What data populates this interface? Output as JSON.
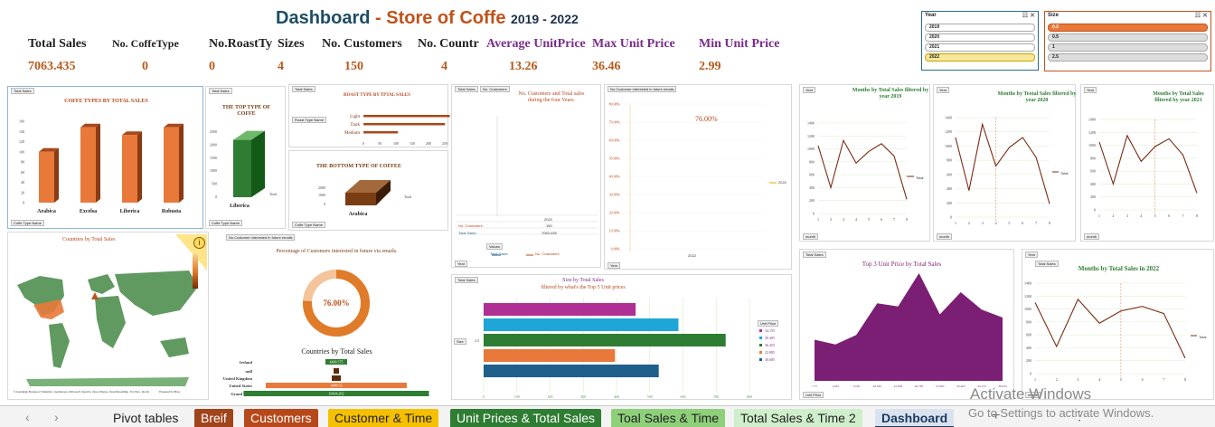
{
  "header": {
    "title_a": "Dashboard",
    "title_sep": " - ",
    "title_b": "Store of Coffe",
    "years": "2019 - 2022"
  },
  "kpis": [
    {
      "label": "Total Sales",
      "value": "7063.435"
    },
    {
      "label": "No. CoffeType",
      "value": "0"
    },
    {
      "label": "No.RoastTy",
      "value": "0"
    },
    {
      "label": "Sizes",
      "value": "4"
    },
    {
      "label": "No. Customers",
      "value": "150"
    },
    {
      "label": "No. Countr",
      "value": "4"
    },
    {
      "label": "Average UnitPrice",
      "value": "13.26"
    },
    {
      "label": "Max Unit Price",
      "value": "36.46"
    },
    {
      "label": "Min Unit Price",
      "value": "2.99"
    }
  ],
  "slicers": {
    "year": {
      "title": "Year",
      "items": [
        "2019",
        "2020",
        "2021",
        "2022"
      ],
      "selected": "2022"
    },
    "size": {
      "title": "Size",
      "items": [
        "0.2",
        "0.5",
        "1",
        "2.5"
      ],
      "selected": "0.2"
    }
  },
  "buttons": {
    "total_sales": "Total Sales",
    "no_customers": "No. Customers",
    "coffee_type_name": "Coffe Type Name",
    "roast_type_name": "Roast Type Name",
    "sum_customers": "No.Customer interested in future emails",
    "values": "Values",
    "year": "Year",
    "month": "month",
    "size": "Size",
    "unit_price": "Unit Price"
  },
  "colors": {
    "orange": "#e8793a",
    "brown": "#7a3c12",
    "green": "#2e7d32",
    "purple": "#7b1f74",
    "blue": "#1f5f8b",
    "cyan": "#1fa6d8",
    "magenta": "#b02f95",
    "dashboard_tab": "#d9e3f0"
  },
  "panels": {
    "coffee_types": {
      "title": "COFFE TYPES  BY  TOTAL SALES"
    },
    "top_type": {
      "title": "THE TOP TYPE OF COFFE"
    },
    "roast_type": {
      "title": "ROAST TYPE BY TPTAL SALES"
    },
    "bottom_type": {
      "title": "THE BOTTOM TYPE OF COFFEE"
    },
    "customers_sales": {
      "title": "No. Customers and Total sales during the four Years.",
      "legend_customers": "No. Customers",
      "legend_sales": "Total Sales",
      "customers_value": "150",
      "sales_value": "7063.435",
      "year_label": "2022"
    },
    "pct_line": {
      "pct": "76.00%",
      "legend": "2022",
      "x": "2022"
    },
    "countries_map": {
      "title": "Countries by Total Sales",
      "badge": "i",
      "credit": "© Australian Bureau of Statistics, GeoNames, Microsoft, Navinfo, Open Places, OpenStreetMap, TomTom, Zenrin",
      "powered": "Powered by Bing"
    },
    "email_pct": {
      "title": "Percentage of Customers interested in future via emails.",
      "value": "76.00%"
    },
    "size_sales": {
      "title": "Size by Total Sales",
      "subtitle": "filtered by what's the Top 5 Unit prices",
      "legend": [
        "34.155",
        "30.405",
        "36.455",
        "22.885",
        "30.685"
      ]
    },
    "top3": {
      "title": "Top 3 Unit Price by Total Sales"
    },
    "m2019": {
      "title": "Months by Total Sales filtered by year 2019"
    },
    "m2020": {
      "title": "Months by Teotal Sales filtered by year 2020"
    },
    "m2021": {
      "title": "Months by Total Sales filtered by year 2021"
    },
    "m2022": {
      "title": "Months by Total Sales in 2022"
    },
    "series_total": "Total"
  },
  "tabs": [
    "Pivot tables",
    "Breif",
    "Customers",
    "Customer & Time",
    "Unit Prices & Total Sales",
    "Toal Sales & Time",
    "Total Sales & Time 2",
    "Dashboard"
  ],
  "activate": {
    "line1": "Activate Windows",
    "line2": "Go to Settings to activate Windows."
  },
  "chart_data": [
    {
      "type": "bar",
      "title": "COFFE TYPES  BY  TOTAL SALES",
      "categories": [
        "Arabica",
        "Excelsa",
        "Liberica",
        "Robusta"
      ],
      "values": [
        100,
        148,
        133,
        148
      ],
      "y_ticks": [
        "0",
        "20",
        "40",
        "60",
        "80",
        "100",
        "120",
        "140",
        "160"
      ],
      "ylim": [
        0,
        160
      ]
    },
    {
      "type": "bar",
      "title": "THE TOP TYPE OF COFFE",
      "categories": [
        "Liberica"
      ],
      "values": [
        2200
      ],
      "y_ticks": [
        "0",
        "500",
        "1000",
        "1500",
        "2000",
        "2500"
      ],
      "legend": "Total"
    },
    {
      "type": "bar",
      "title": "ROAST TYPE BY TPTAL SALES",
      "categories": [
        "Light",
        "Dark",
        "Medium"
      ],
      "values": [
        270,
        255,
        108
      ],
      "x_ticks": [
        "0",
        "50",
        "100",
        "150",
        "200",
        "250"
      ],
      "xlim": [
        0,
        300
      ]
    },
    {
      "type": "bar",
      "title": "THE BOTTOM TYPE OF COFFEE",
      "categories": [
        "Arabica"
      ],
      "values": [
        1500
      ],
      "y_ticks": [
        "0",
        "1000",
        "2000"
      ],
      "legend": "Total"
    },
    {
      "type": "area",
      "title": "Top 3 Unit Price by Total Sales",
      "x": [
        "7.77",
        "14.85",
        "15.85",
        "20.585",
        "22.885",
        "29.785",
        "31.085",
        "33.465",
        "34.155",
        "36.455"
      ],
      "values": [
        260,
        230,
        290,
        490,
        470,
        680,
        420,
        560,
        450,
        400
      ],
      "ylim": [
        0,
        800
      ]
    },
    {
      "type": "line",
      "title": "Months by Total Sales filtered by year 2019",
      "x": [
        1,
        2,
        3,
        4,
        5,
        6,
        7,
        8
      ],
      "values": [
        1050,
        400,
        1130,
        780,
        960,
        1080,
        890,
        220
      ],
      "y_ticks": [
        "0",
        "200",
        "400",
        "600",
        "800",
        "1000",
        "1200",
        "1400"
      ],
      "ylim": [
        0,
        1400
      ]
    },
    {
      "type": "line",
      "title": "Months by Teotal Sales filtered by year 2020",
      "x": [
        1,
        2,
        3,
        4,
        5,
        6,
        7,
        8
      ],
      "values": [
        1200,
        400,
        1400,
        770,
        1050,
        1200,
        900,
        200
      ],
      "y_ticks": [
        "0",
        "200",
        "400",
        "600",
        "800",
        "1000",
        "1200",
        "1400"
      ],
      "ylim": [
        0,
        1500
      ]
    },
    {
      "type": "line",
      "title": "Months by Total Sales filtered by year 2021",
      "x": [
        1,
        2,
        3,
        4,
        5,
        6,
        7,
        8
      ],
      "values": [
        1050,
        400,
        1150,
        750,
        980,
        1100,
        850,
        260
      ],
      "y_ticks": [
        "0",
        "200",
        "400",
        "600",
        "800",
        "1000",
        "1200",
        "1400"
      ],
      "ylim": [
        0,
        1400
      ]
    },
    {
      "type": "line",
      "title": "Months by Total Sales in 2022",
      "x": [
        1,
        2,
        3,
        4,
        5,
        6,
        7,
        8
      ],
      "values": [
        1100,
        420,
        1150,
        780,
        970,
        1040,
        930,
        240
      ],
      "y_ticks": [
        "0",
        "200",
        "400",
        "600",
        "800",
        "1000",
        "1200",
        "1400"
      ],
      "ylim": [
        0,
        1400
      ]
    },
    {
      "type": "bar",
      "title": "Size by Total Sales",
      "categories": [
        "34.155",
        "30.405",
        "36.455",
        "22.885",
        "30.685"
      ],
      "values": [
        486,
        623,
        774,
        420,
        560
      ],
      "x_ticks": [
        "0",
        "100",
        "200",
        "300",
        "400",
        "500",
        "600",
        "700",
        "800"
      ],
      "xlim": [
        0,
        850
      ]
    },
    {
      "type": "bar",
      "title": "Countries by Total Sales",
      "categories": [
        "Ireland",
        "null",
        "United Kingdom",
        "United States",
        "Grand Total"
      ],
      "values": [
        450,
        30,
        450,
        5000,
        7063
      ],
      "labels": [
        "4400.575",
        "",
        "",
        "3488.53",
        "10434.262"
      ]
    }
  ]
}
